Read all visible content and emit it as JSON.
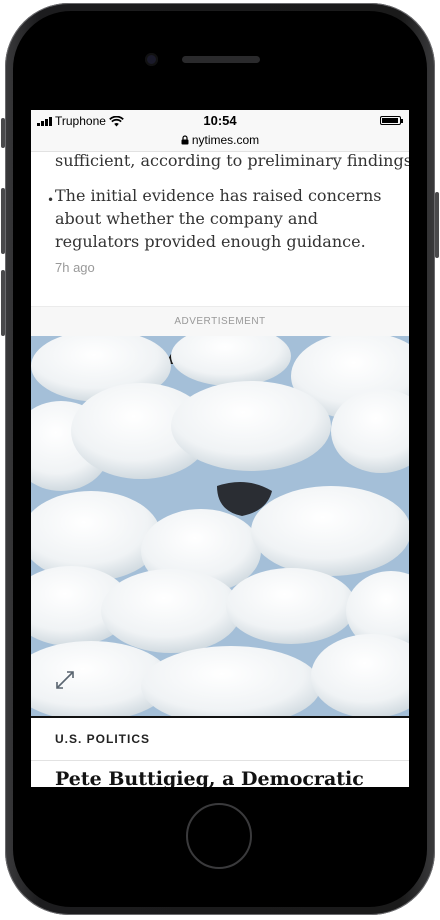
{
  "status_bar": {
    "carrier": "Truphone",
    "time": "10:54",
    "battery_level": 0.95
  },
  "browser": {
    "url": "nytimes.com"
  },
  "article": {
    "previous_line": "sufficient, according to preliminary findings.",
    "bullet_text": "The initial evidence has raised concerns about whether the company and regulators provided enough guidance.",
    "time_ago": "7h ago"
  },
  "advertisement": {
    "label": "ADVERTISEMENT",
    "sky_color": "#a4bfd8"
  },
  "next_section": {
    "label": "U.S. POLITICS",
    "headline": "Pete Buttigieg, a Democratic"
  },
  "icons": [
    "wifi-icon",
    "lock-icon",
    "expand-icon",
    "signal-icon",
    "battery-icon"
  ]
}
